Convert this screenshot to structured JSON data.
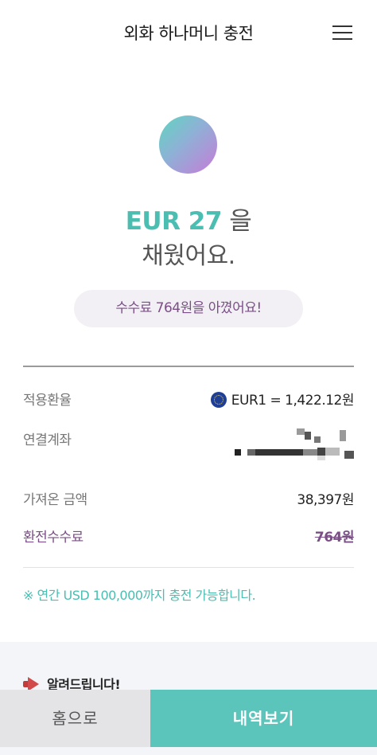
{
  "header": {
    "title": "외화 하나머니 충전",
    "menu_icon": "hamburger-menu-icon"
  },
  "result": {
    "amount": "EUR 27",
    "suffix": " 을",
    "line2": "채웠어요."
  },
  "saving_message": "수수료 764원을 아꼈어요!",
  "details": {
    "rate_label": "적용환율",
    "rate_icon": "eu-flag-icon",
    "rate_value": "EUR1 = 1,422.12원",
    "account_label": "연결계좌",
    "amount_label": "가져온 금액",
    "amount_value": "38,397원",
    "fee_label": "환전수수료",
    "fee_value": "764원"
  },
  "notice_line": "※ 연간 USD 100,000까지 충전 가능합니다.",
  "announcement": {
    "icon": "megaphone-icon",
    "title": "알려드립니다!"
  },
  "buttons": {
    "home": "홈으로",
    "history": "내역보기"
  },
  "colors": {
    "accent": "#5cc5bb",
    "fee_purple": "#7a4f86"
  }
}
